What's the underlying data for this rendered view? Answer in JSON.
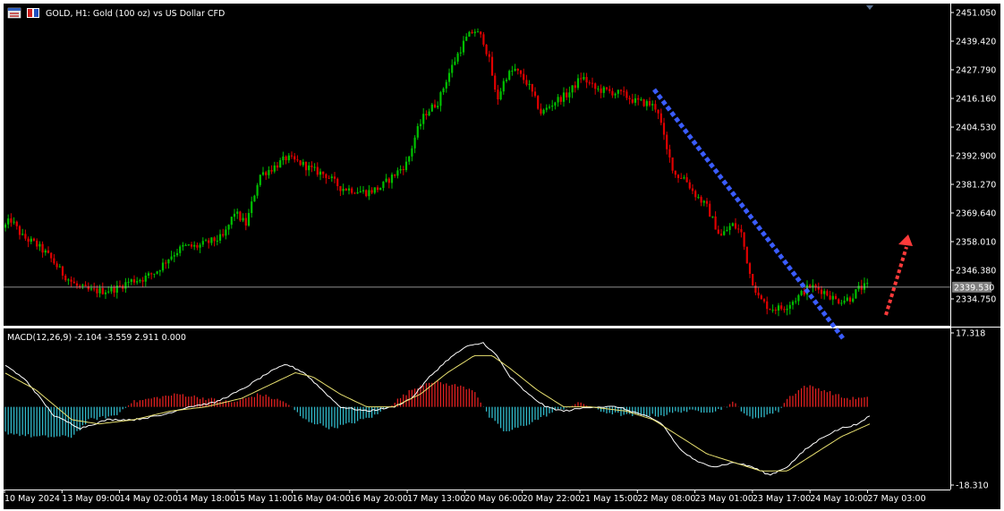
{
  "header": {
    "symbol_line": "GOLD, H1:  Gold (100 oz) vs US Dollar CFD",
    "icons": [
      "window-icon",
      "one-click-trading-icon"
    ]
  },
  "macd_header": "MACD(12,26,9) -2.104 -3.559 2.911 0.000",
  "colors": {
    "background": "#000000",
    "bull": "#00c000",
    "bear": "#e00000",
    "grid_line": "#c0c0c0",
    "current_price_bg": "#808080",
    "trend_line": "#3a5cff",
    "arrow": "#ff3a3a",
    "macd_pos": "#e02020",
    "macd_neg": "#30b8c8",
    "macd_main": "#ffffff",
    "macd_signal": "#e8e070"
  },
  "price_axis": {
    "ticks": [
      "2451.050",
      "2439.420",
      "2427.790",
      "2416.160",
      "2404.530",
      "2392.900",
      "2381.270",
      "2369.640",
      "2358.010",
      "2346.380",
      "2334.750"
    ],
    "current_price": "2339.530"
  },
  "macd_axis": {
    "ticks": [
      "17.318",
      "-18.310"
    ]
  },
  "time_axis": {
    "ticks": [
      "10 May 2024",
      "13 May 09:00",
      "14 May 02:00",
      "14 May 18:00",
      "15 May 11:00",
      "16 May 04:00",
      "16 May 20:00",
      "17 May 13:00",
      "20 May 06:00",
      "20 May 22:00",
      "21 May 15:00",
      "22 May 08:00",
      "23 May 01:00",
      "23 May 17:00",
      "24 May 10:00",
      "27 May 03:00"
    ]
  },
  "chart_data": {
    "type": "candlestick",
    "symbol": "GOLD",
    "timeframe": "H1",
    "ylim": [
      2330,
      2453
    ],
    "close_path": [
      [
        0,
        2362
      ],
      [
        12,
        2367
      ],
      [
        25,
        2360
      ],
      [
        40,
        2357
      ],
      [
        55,
        2352
      ],
      [
        70,
        2345
      ],
      [
        85,
        2340
      ],
      [
        100,
        2338
      ],
      [
        115,
        2338
      ],
      [
        130,
        2339
      ],
      [
        145,
        2342
      ],
      [
        160,
        2343
      ],
      [
        175,
        2346
      ],
      [
        190,
        2352
      ],
      [
        205,
        2356
      ],
      [
        220,
        2356
      ],
      [
        235,
        2358
      ],
      [
        250,
        2360
      ],
      [
        262,
        2370
      ],
      [
        275,
        2365
      ],
      [
        290,
        2385
      ],
      [
        305,
        2388
      ],
      [
        320,
        2392
      ],
      [
        335,
        2390
      ],
      [
        350,
        2387
      ],
      [
        365,
        2385
      ],
      [
        380,
        2380
      ],
      [
        395,
        2379
      ],
      [
        410,
        2378
      ],
      [
        425,
        2380
      ],
      [
        440,
        2385
      ],
      [
        455,
        2390
      ],
      [
        465,
        2402
      ],
      [
        475,
        2410
      ],
      [
        490,
        2415
      ],
      [
        500,
        2425
      ],
      [
        510,
        2433
      ],
      [
        520,
        2440
      ],
      [
        530,
        2444
      ],
      [
        540,
        2440
      ],
      [
        548,
        2430
      ],
      [
        555,
        2415
      ],
      [
        565,
        2425
      ],
      [
        575,
        2428
      ],
      [
        590,
        2422
      ],
      [
        605,
        2410
      ],
      [
        620,
        2415
      ],
      [
        635,
        2418
      ],
      [
        650,
        2425
      ],
      [
        665,
        2420
      ],
      [
        680,
        2419
      ],
      [
        695,
        2418
      ],
      [
        710,
        2415
      ],
      [
        725,
        2414
      ],
      [
        735,
        2412
      ],
      [
        745,
        2395
      ],
      [
        755,
        2385
      ],
      [
        765,
        2384
      ],
      [
        775,
        2378
      ],
      [
        790,
        2372
      ],
      [
        805,
        2360
      ],
      [
        818,
        2365
      ],
      [
        828,
        2362
      ],
      [
        838,
        2345
      ],
      [
        848,
        2335
      ],
      [
        860,
        2331
      ],
      [
        875,
        2331
      ],
      [
        890,
        2335
      ],
      [
        905,
        2340
      ],
      [
        920,
        2338
      ],
      [
        935,
        2334
      ],
      [
        950,
        2335
      ],
      [
        960,
        2339
      ],
      [
        970,
        2340
      ]
    ],
    "macd_histogram_path": [
      [
        5,
        -6
      ],
      [
        40,
        -7
      ],
      [
        80,
        -7
      ],
      [
        100,
        -3
      ],
      [
        130,
        -2
      ],
      [
        145,
        1
      ],
      [
        170,
        2
      ],
      [
        200,
        3
      ],
      [
        230,
        2
      ],
      [
        260,
        1
      ],
      [
        290,
        3
      ],
      [
        320,
        1
      ],
      [
        340,
        -3
      ],
      [
        370,
        -5
      ],
      [
        390,
        -4
      ],
      [
        420,
        -2
      ],
      [
        440,
        1
      ],
      [
        460,
        4
      ],
      [
        480,
        6
      ],
      [
        510,
        5
      ],
      [
        530,
        4
      ],
      [
        545,
        -2
      ],
      [
        565,
        -6
      ],
      [
        590,
        -4
      ],
      [
        620,
        -1
      ],
      [
        650,
        1
      ],
      [
        670,
        -1
      ],
      [
        700,
        -2
      ],
      [
        740,
        -2
      ],
      [
        760,
        -1
      ],
      [
        800,
        -1
      ],
      [
        820,
        1
      ],
      [
        840,
        -3
      ],
      [
        870,
        -1
      ],
      [
        880,
        2
      ],
      [
        900,
        5
      ],
      [
        920,
        4
      ],
      [
        945,
        2
      ],
      [
        972,
        2
      ]
    ],
    "macd_main_path": [
      [
        5,
        10
      ],
      [
        30,
        6
      ],
      [
        60,
        -2
      ],
      [
        90,
        -5
      ],
      [
        120,
        -3
      ],
      [
        150,
        -3
      ],
      [
        180,
        -2
      ],
      [
        210,
        0
      ],
      [
        240,
        1
      ],
      [
        270,
        4
      ],
      [
        300,
        8
      ],
      [
        320,
        10
      ],
      [
        340,
        8
      ],
      [
        360,
        4
      ],
      [
        380,
        0
      ],
      [
        410,
        -1
      ],
      [
        440,
        0
      ],
      [
        460,
        2
      ],
      [
        480,
        7
      ],
      [
        500,
        11
      ],
      [
        520,
        14
      ],
      [
        540,
        15
      ],
      [
        555,
        12
      ],
      [
        570,
        7
      ],
      [
        590,
        3
      ],
      [
        610,
        0
      ],
      [
        630,
        -1
      ],
      [
        660,
        0
      ],
      [
        690,
        0
      ],
      [
        720,
        -2
      ],
      [
        740,
        -4
      ],
      [
        760,
        -10
      ],
      [
        780,
        -13
      ],
      [
        800,
        -14
      ],
      [
        820,
        -13
      ],
      [
        840,
        -14
      ],
      [
        860,
        -16
      ],
      [
        880,
        -14
      ],
      [
        900,
        -10
      ],
      [
        920,
        -7
      ],
      [
        940,
        -5
      ],
      [
        960,
        -4
      ],
      [
        972,
        -2
      ]
    ],
    "macd_signal_path": [
      [
        5,
        8
      ],
      [
        40,
        4
      ],
      [
        80,
        -3
      ],
      [
        110,
        -4
      ],
      [
        150,
        -3
      ],
      [
        190,
        -1
      ],
      [
        230,
        0
      ],
      [
        270,
        2
      ],
      [
        300,
        5
      ],
      [
        330,
        8
      ],
      [
        350,
        7
      ],
      [
        380,
        3
      ],
      [
        410,
        0
      ],
      [
        440,
        0
      ],
      [
        470,
        3
      ],
      [
        500,
        8
      ],
      [
        530,
        12
      ],
      [
        550,
        12
      ],
      [
        570,
        9
      ],
      [
        600,
        4
      ],
      [
        630,
        0
      ],
      [
        660,
        0
      ],
      [
        700,
        -1
      ],
      [
        730,
        -3
      ],
      [
        760,
        -7
      ],
      [
        790,
        -11
      ],
      [
        820,
        -13
      ],
      [
        850,
        -15
      ],
      [
        880,
        -15
      ],
      [
        910,
        -11
      ],
      [
        940,
        -7
      ],
      [
        972,
        -4
      ]
    ],
    "annotations": {
      "trend_line": {
        "style": "dotted",
        "color": "blue",
        "from_price": 2420,
        "to_price": 2328
      },
      "arrow": {
        "style": "dotted",
        "color": "red",
        "direction": "up"
      }
    }
  }
}
